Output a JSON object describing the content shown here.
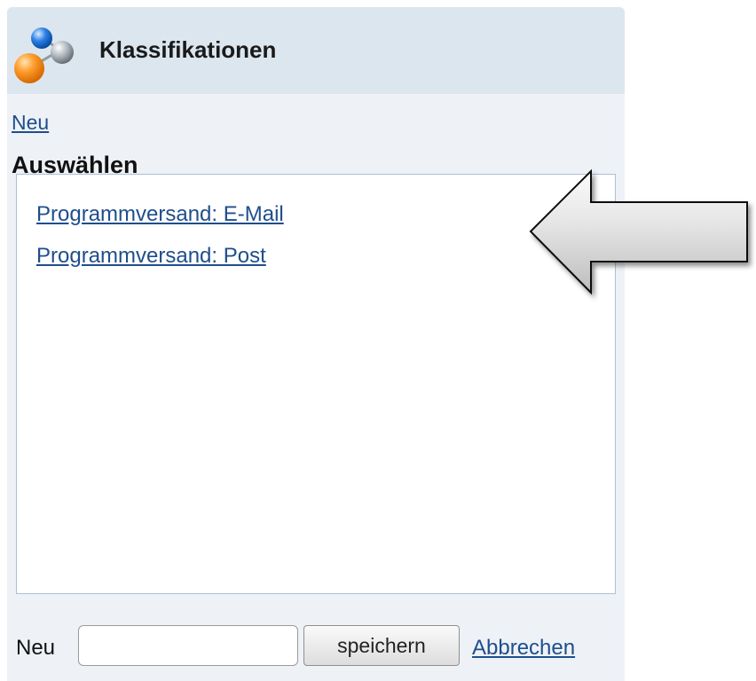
{
  "panel": {
    "title": "Klassifikationen",
    "new_link": "Neu",
    "select_label": "Auswählen",
    "list_items": [
      "Programmversand: E-Mail",
      "Programmversand: Post"
    ]
  },
  "footer": {
    "new_label": "Neu",
    "input_value": "",
    "save_label": "speichern",
    "cancel_label": "Abbrechen"
  },
  "icons": {
    "header": "colored-spheres-icon",
    "annotation": "left-arrow-icon"
  },
  "colors": {
    "header_background": "#dce6ef",
    "panel_background": "#eef2f7",
    "link": "#1f4e8c"
  }
}
